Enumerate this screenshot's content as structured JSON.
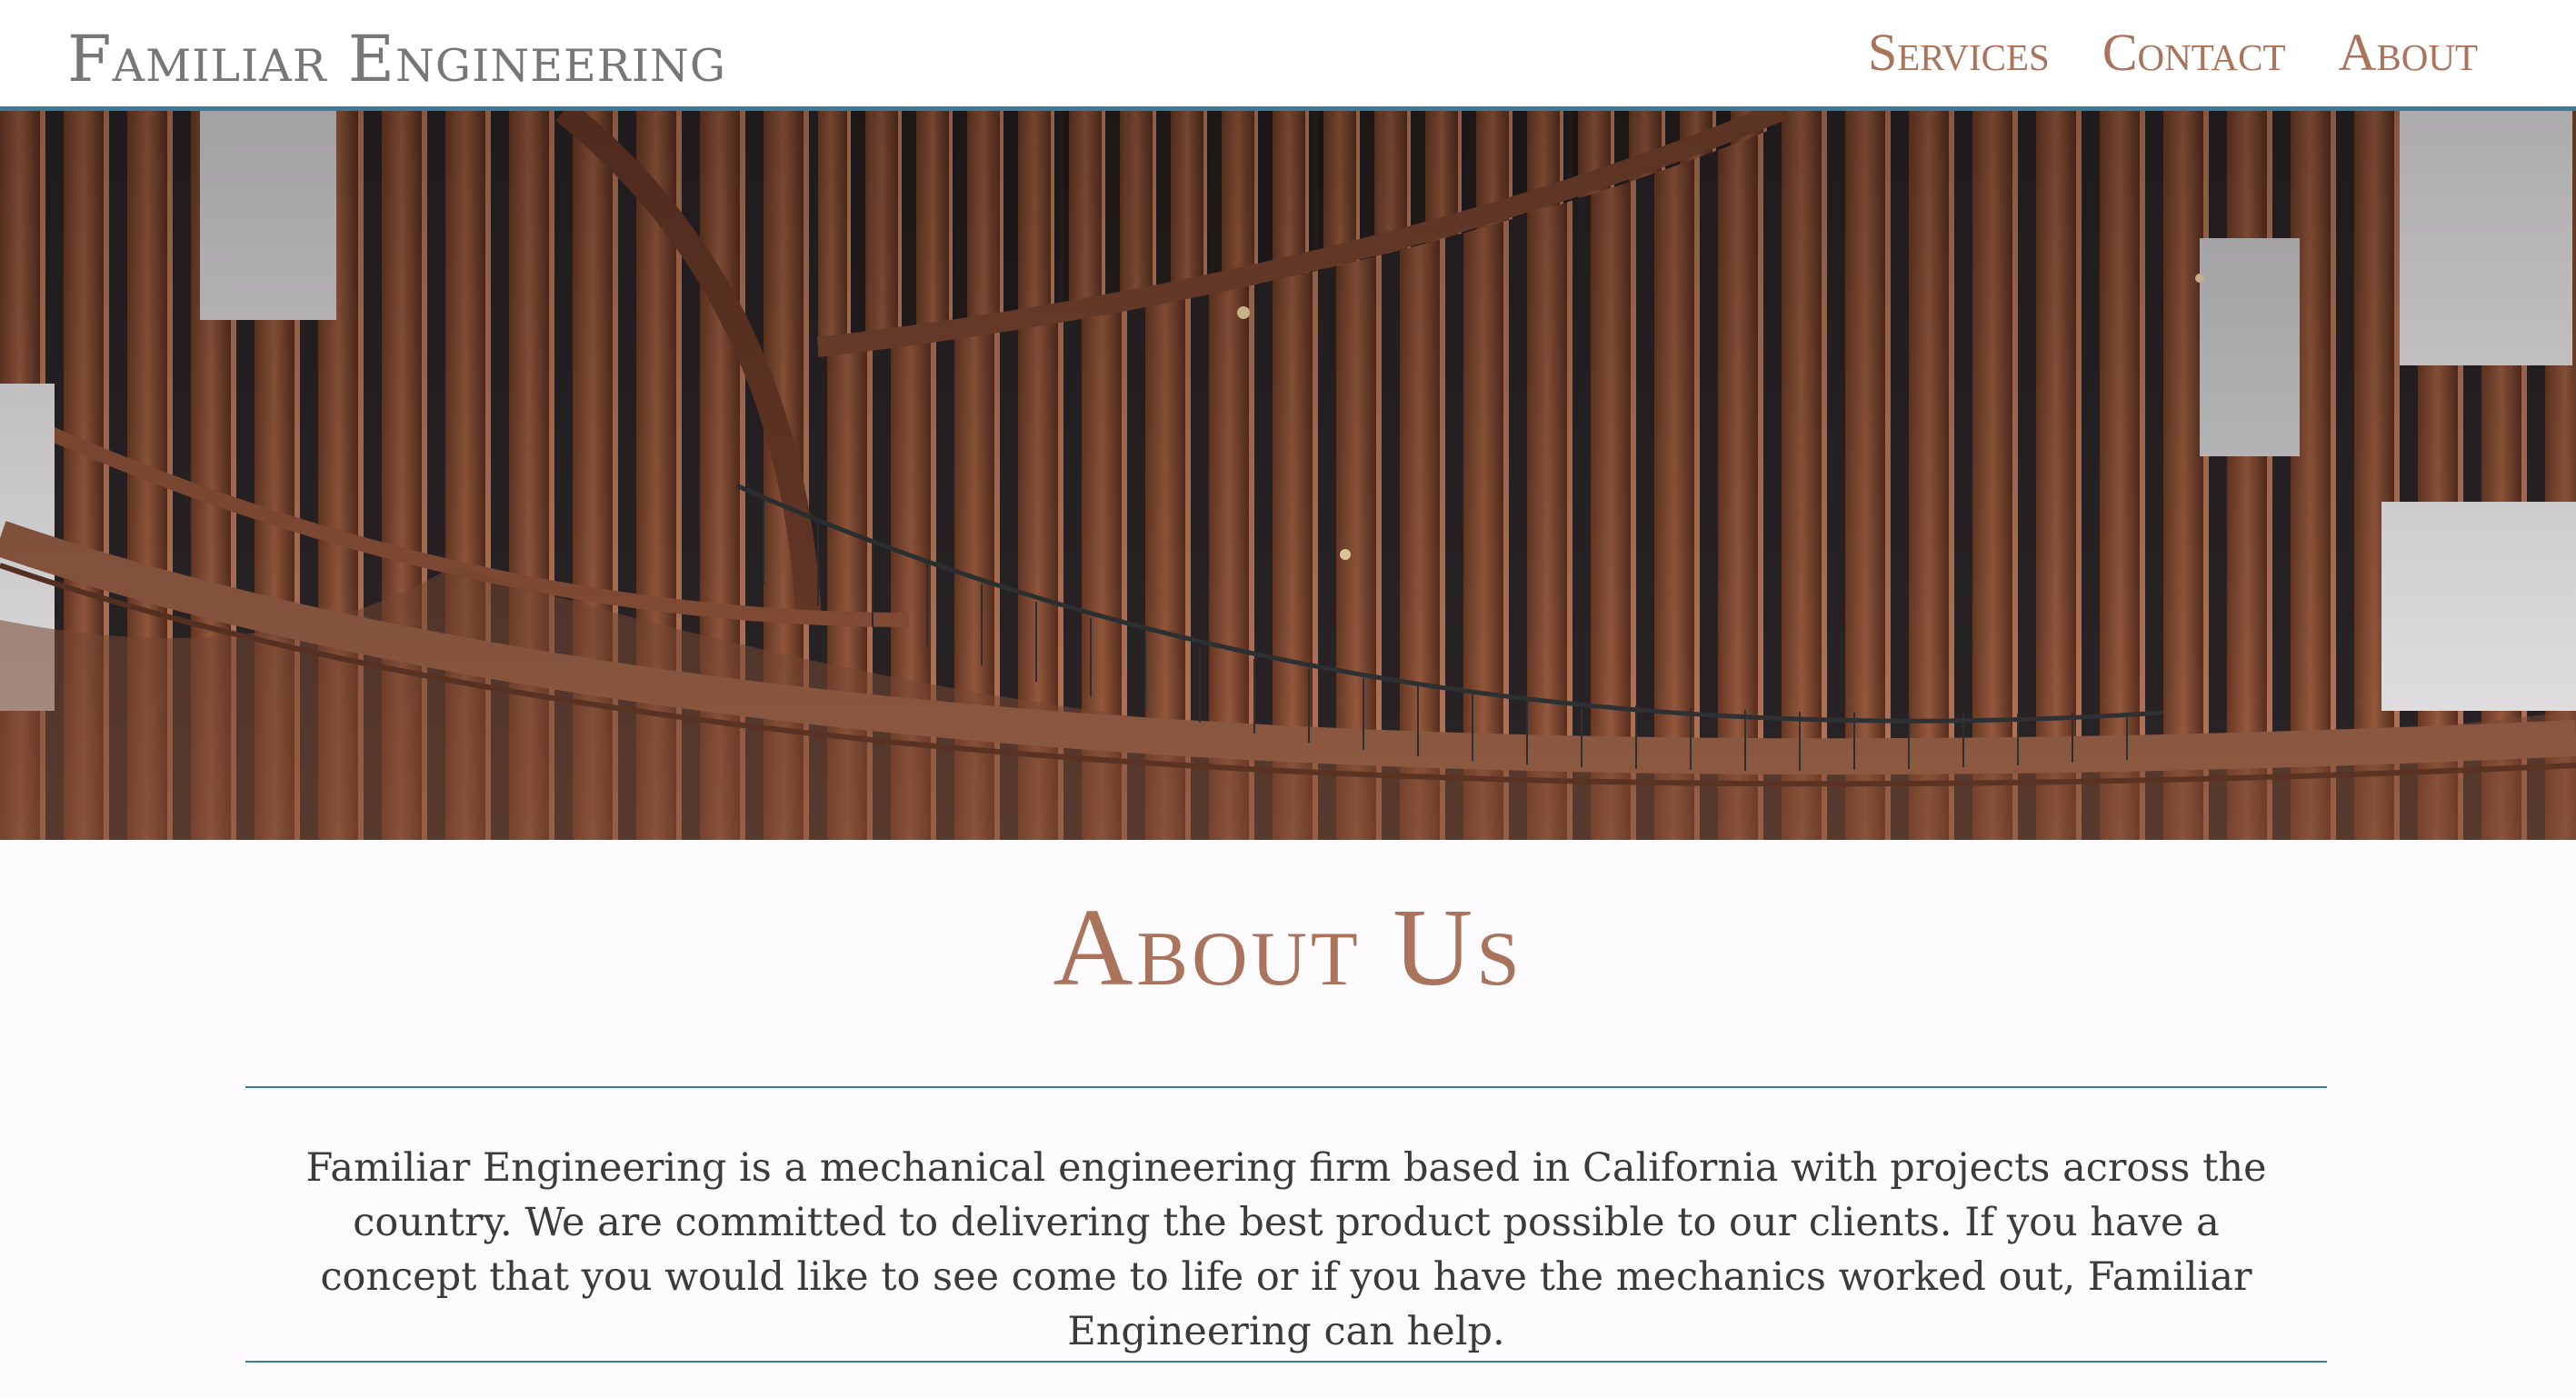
{
  "header": {
    "brand": "Familiar Engineering",
    "nav": [
      {
        "label": "Services"
      },
      {
        "label": "Contact"
      },
      {
        "label": "About"
      }
    ]
  },
  "hero": {
    "image": "curved-copper-building-facade-photo"
  },
  "about": {
    "title": "About Us",
    "body": "Familiar Engineering is a mechanical engineering firm based in California with projects across the country. We are committed to delivering the best product possible to our clients. If you have a concept that you would like to see come to life or if you have the mechanics worked out, Familiar Engineering can help."
  },
  "colors": {
    "accent": "#a9735c",
    "rule": "#3c7a99",
    "brand_text": "#777777",
    "body_text": "#3b3b3b",
    "background": "#fdfbfd"
  }
}
